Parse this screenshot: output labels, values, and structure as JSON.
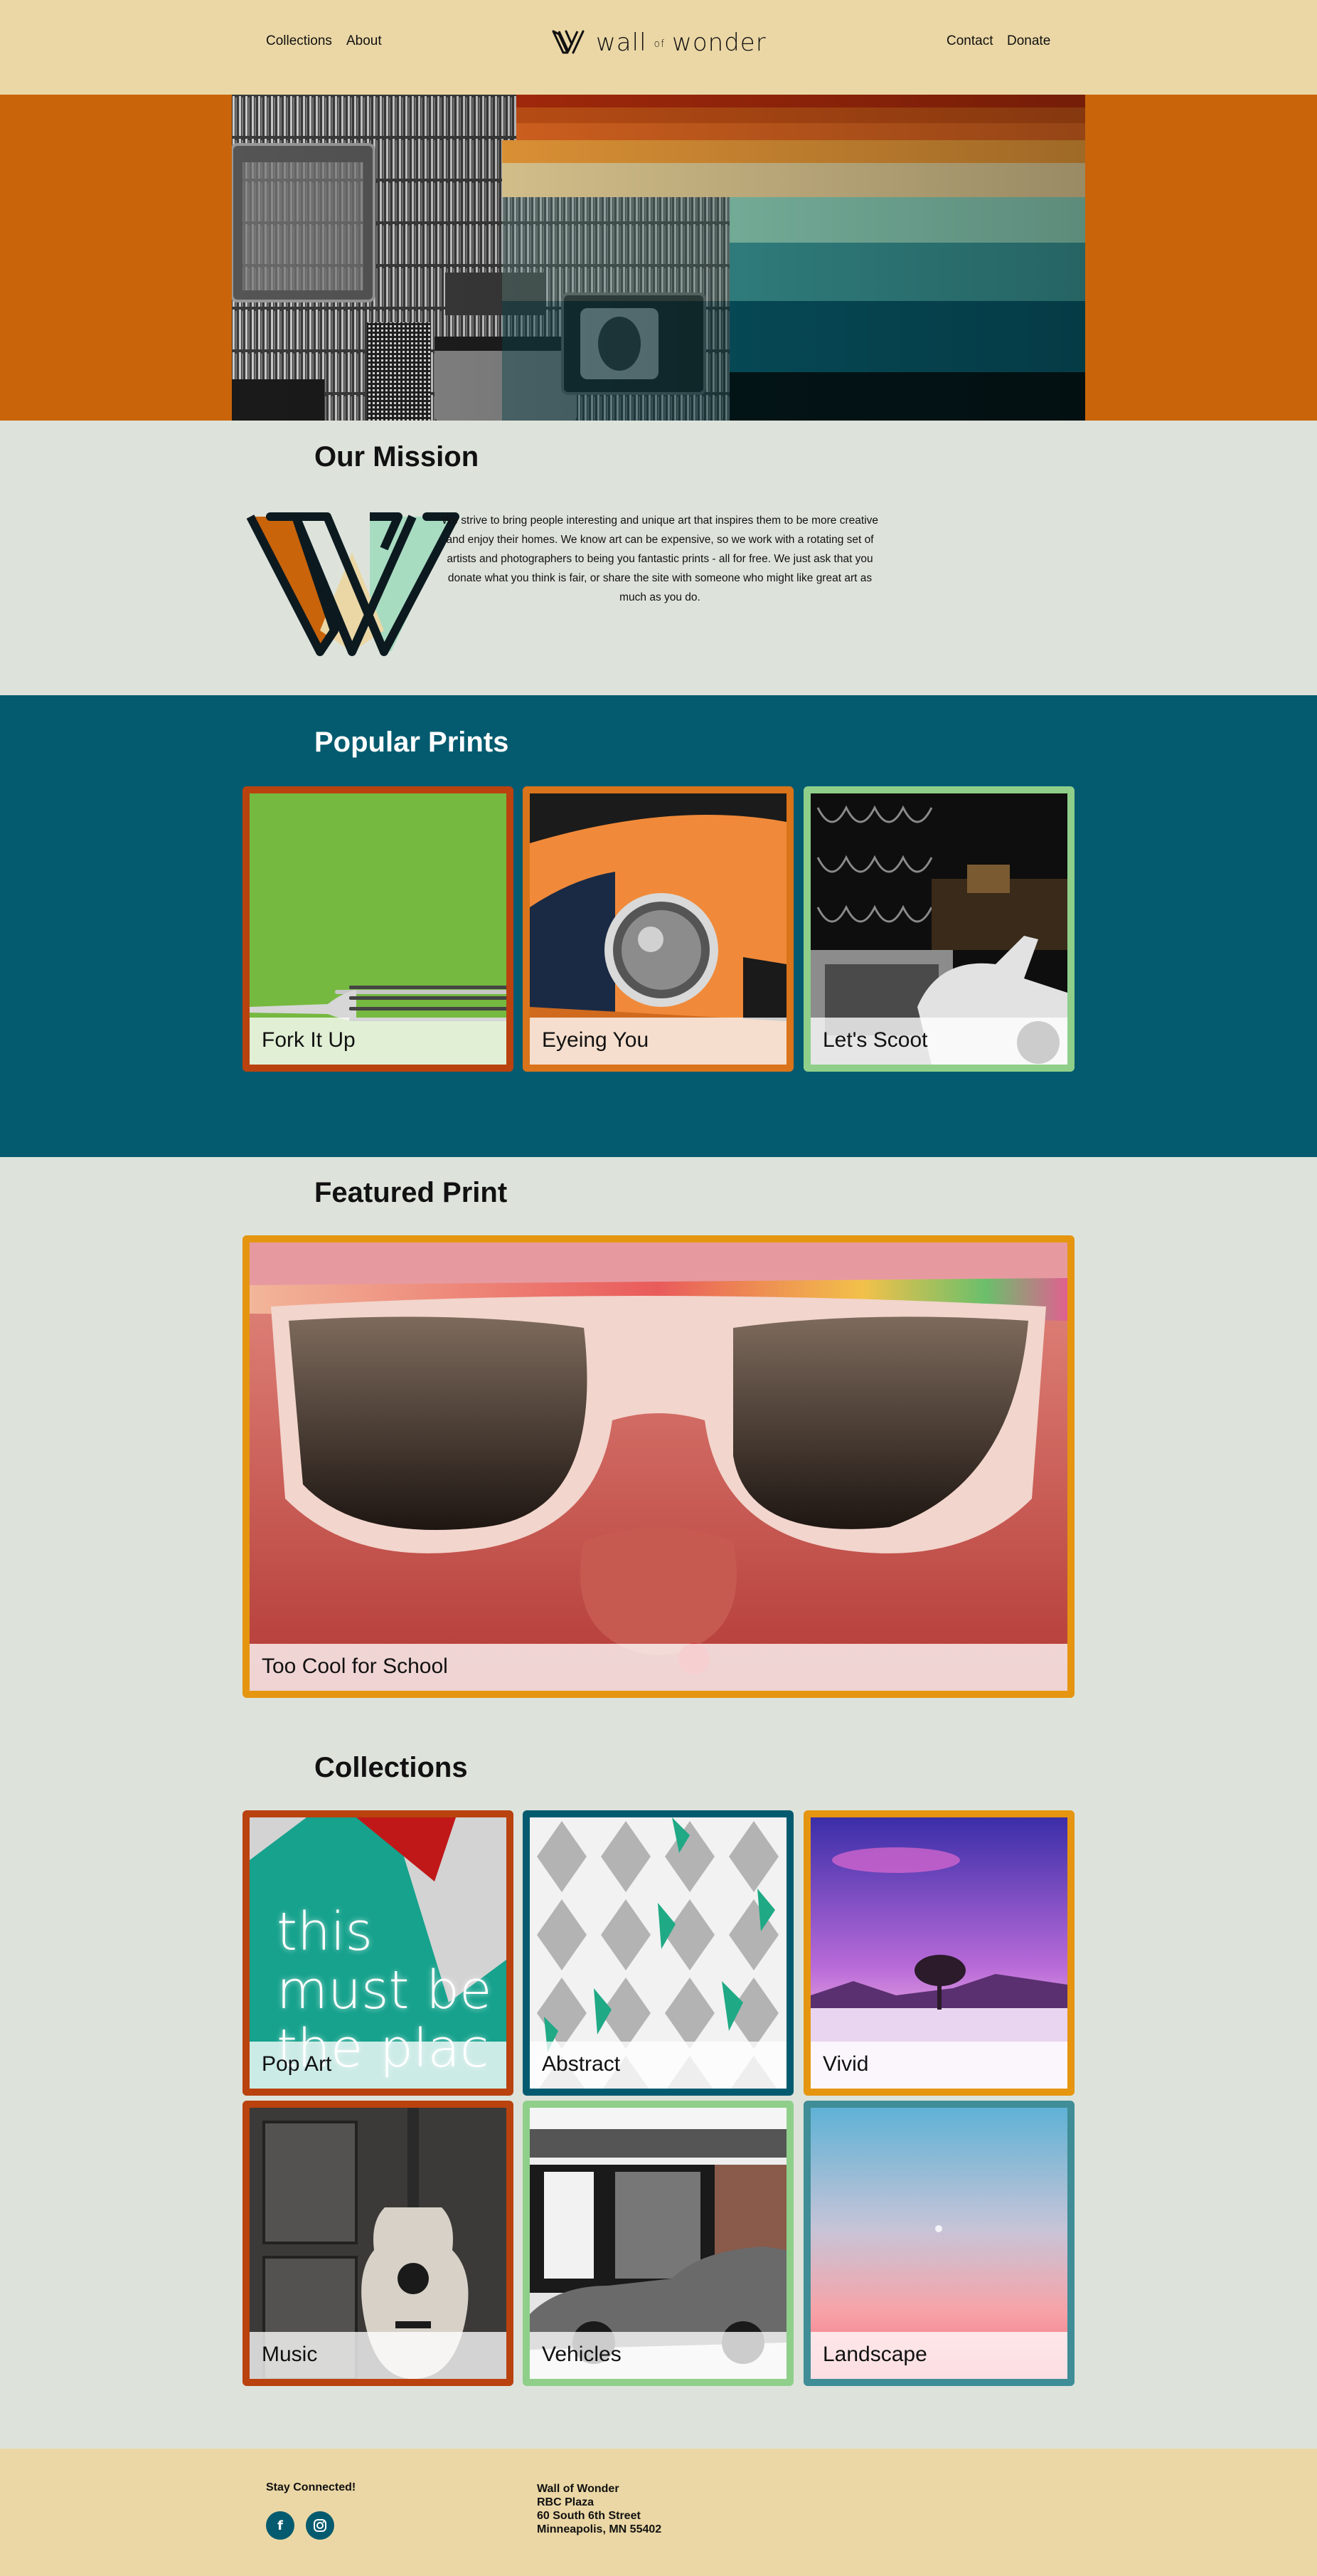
{
  "nav": {
    "collections": "Collections",
    "about": "About",
    "contact": "Contact",
    "donate": "Donate"
  },
  "brand": {
    "word1": "wall",
    "of": "of",
    "word2": "wonder"
  },
  "colors": {
    "header_bg": "#ebd7a5",
    "hero_bg": "#c9640a",
    "section_bg": "#dde3db",
    "teal": "#045b6f",
    "rust": "#b9420f",
    "orange": "#d9741a",
    "amber": "#e59510",
    "mint": "#8fcf8a",
    "aqua": "#3f8d96"
  },
  "mission": {
    "title": "Our Mission",
    "text": "We strive to bring people interesting and unique art that inspires them to be more creative and enjoy their homes. We know art can be expensive, so we work with a rotating set of artists and photographers to being you fantastic prints - all for free. We just ask that you donate what you think is fair, or share the site with someone who might like great art as much as you do."
  },
  "popular": {
    "title": "Popular Prints",
    "items": [
      {
        "label": "Fork It Up"
      },
      {
        "label": "Eyeing You"
      },
      {
        "label": "Let's Scoot"
      }
    ]
  },
  "featured": {
    "title": "Featured Print",
    "label": "Too Cool for School"
  },
  "collections": {
    "title": "Collections",
    "items": [
      {
        "label": "Pop Art",
        "sign": "this must be the plac"
      },
      {
        "label": "Abstract"
      },
      {
        "label": "Vivid"
      },
      {
        "label": "Music"
      },
      {
        "label": "Vehicles"
      },
      {
        "label": "Landscape"
      }
    ]
  },
  "footer": {
    "stay": "Stay Connected!",
    "facebook_icon": "facebook-icon",
    "instagram_icon": "instagram-icon",
    "address": {
      "name": "Wall of Wonder",
      "line1": "RBC Plaza",
      "line2": "60 South 6th Street",
      "line3": "Minneapolis, MN 55402"
    }
  }
}
